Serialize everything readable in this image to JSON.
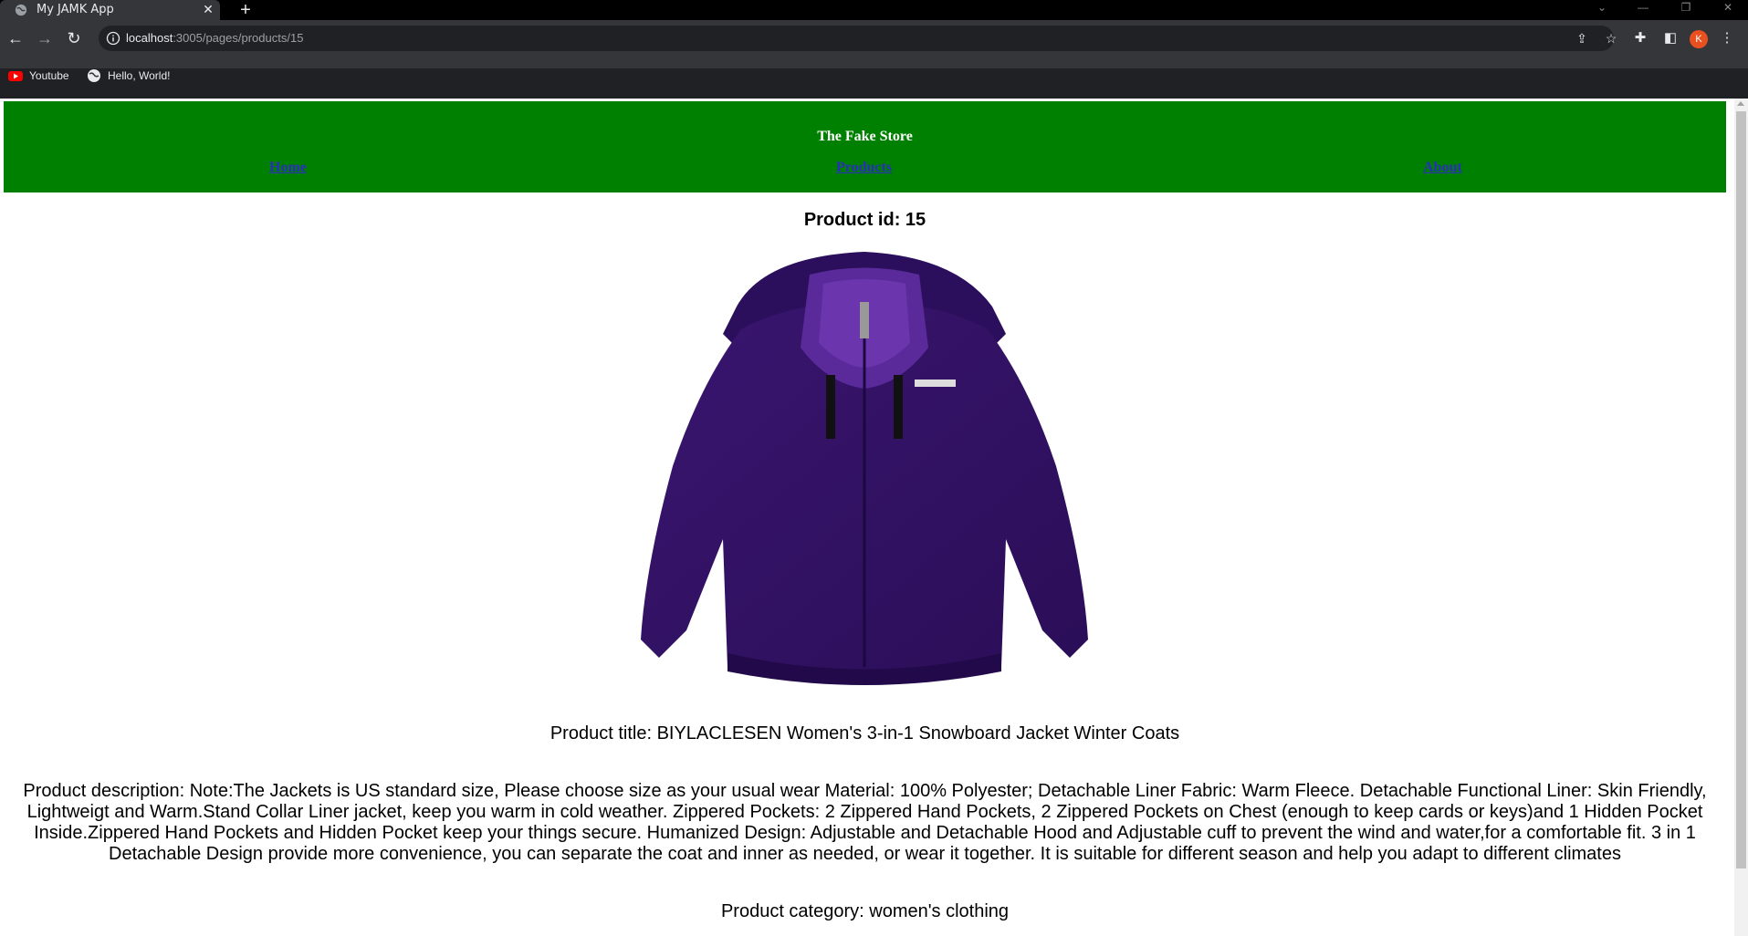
{
  "browser": {
    "tab_title": "My JAMK App",
    "tab_close": "✕",
    "new_tab": "+",
    "url_host": "localhost",
    "url_rest": ":3005/pages/products/15",
    "avatar_letter": "K",
    "bookmarks": [
      {
        "label": "Youtube",
        "icon": "youtube-icon"
      },
      {
        "label": "Hello, World!",
        "icon": "globe-icon"
      }
    ]
  },
  "site": {
    "title": "The Fake Store",
    "nav": [
      {
        "label": "Home"
      },
      {
        "label": "Products"
      },
      {
        "label": "About"
      }
    ],
    "header_color": "#008000"
  },
  "product": {
    "id_text": "Product id: 15",
    "image_alt": "purple jacket",
    "title_text": "Product title: BIYLACLESEN Women's 3-in-1 Snowboard Jacket Winter Coats",
    "description_text": "Product description: Note:The Jackets is US standard size, Please choose size as your usual wear Material: 100% Polyester; Detachable Liner Fabric: Warm Fleece. Detachable Functional Liner: Skin Friendly, Lightweigt and Warm.Stand Collar Liner jacket, keep you warm in cold weather. Zippered Pockets: 2 Zippered Hand Pockets, 2 Zippered Pockets on Chest (enough to keep cards or keys)and 1 Hidden Pocket Inside.Zippered Hand Pockets and Hidden Pocket keep your things secure. Humanized Design: Adjustable and Detachable Hood and Adjustable cuff to prevent the wind and water,for a comfortable fit. 3 in 1 Detachable Design provide more convenience, you can separate the coat and inner as needed, or wear it together. It is suitable for different season and help you adapt to different climates",
    "category_text": "Product category: women's clothing"
  }
}
